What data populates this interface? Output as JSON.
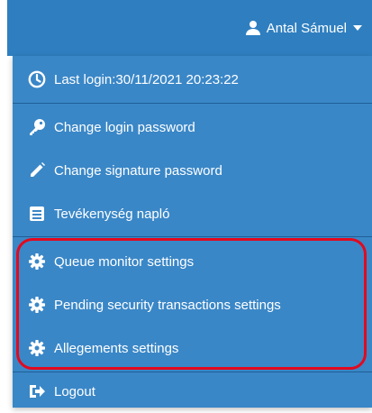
{
  "header": {
    "user_name": "Antal Sámuel",
    "user_icon": "user-icon",
    "caret_icon": "caret-down-icon"
  },
  "menu": {
    "items": [
      {
        "label": "Last login:30/11/2021 20:23:22",
        "icon": "clock-icon"
      },
      {
        "label": "Change login password",
        "icon": "key-icon"
      },
      {
        "label": "Change signature password",
        "icon": "pencil-icon"
      },
      {
        "label": "Tevékenység napló",
        "icon": "list-icon"
      },
      {
        "label": "Queue monitor settings",
        "icon": "gear-icon"
      },
      {
        "label": "Pending security transactions settings",
        "icon": "gear-icon"
      },
      {
        "label": "Allegements settings",
        "icon": "gear-icon"
      },
      {
        "label": "Logout",
        "icon": "logout-icon"
      }
    ]
  },
  "colors": {
    "header_bg": "#2f7fc0",
    "menu_bg": "#3a87c7",
    "divider": "#1f5f96",
    "highlight": "#e3091e"
  }
}
